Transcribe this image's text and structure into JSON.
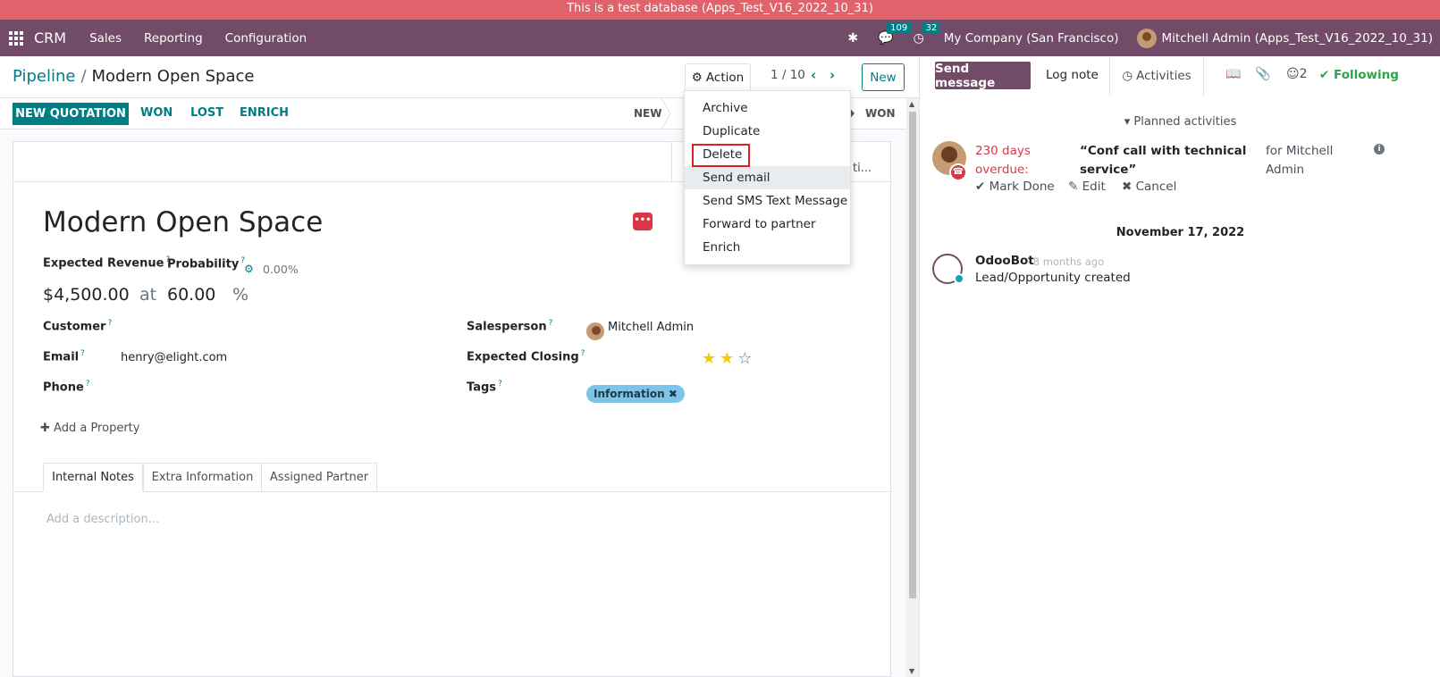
{
  "test_banner": "This is a test database (Apps_Test_V16_2022_10_31)",
  "topnav": {
    "app": "CRM",
    "menu": [
      "Sales",
      "Reporting",
      "Configuration"
    ],
    "messages_count": "109",
    "activities_count": "32",
    "company": "My Company (San Francisco)",
    "user": "Mitchell Admin (Apps_Test_V16_2022_10_31)"
  },
  "control": {
    "breadcrumb_parent": "Pipeline",
    "breadcrumb_sep": "/",
    "breadcrumb_current": "Modern Open Space",
    "action_label": "Action",
    "pager": "1 / 10",
    "new_label": "New"
  },
  "statusbar": {
    "new_quotation": "NEW QUOTATION",
    "won": "WON",
    "lost": "LOST",
    "enrich": "ENRICH",
    "stage_new": "NEW",
    "stage_won": "WON"
  },
  "action_menu": [
    "Archive",
    "Duplicate",
    "Delete",
    "Send email",
    "Send SMS Text Message",
    "Forward to partner",
    "Enrich"
  ],
  "smartbar": {
    "truncated": "ti..."
  },
  "record": {
    "title": "Modern Open Space",
    "expected_revenue_label": "Expected Revenue",
    "probability_label": "Probability",
    "probability_auto": "0.00%",
    "expected_revenue": "$4,500.00",
    "at": "at",
    "probability": "60.00",
    "percent": "%",
    "customer_label": "Customer",
    "email_label": "Email",
    "email": "henry@elight.com",
    "phone_label": "Phone",
    "salesperson_label": "Salesperson",
    "salesperson": "Mitchell Admin",
    "expected_closing_label": "Expected Closing",
    "priority_stars": 2,
    "priority_max": 3,
    "tags_label": "Tags",
    "tag": "Information",
    "add_property": "Add a Property",
    "help_mark": "?"
  },
  "tabs": [
    "Internal Notes",
    "Extra Information",
    "Assigned Partner"
  ],
  "description_placeholder": "Add a description...",
  "chatter": {
    "send_message": "Send message",
    "log_note": "Log note",
    "activities": "Activities",
    "followers_count": "2",
    "following": "Following",
    "planned_activities": "Planned activities",
    "activity": {
      "overdue": "230 days overdue:",
      "summary": "“Conf call with technical service”",
      "for": "for Mitchell Admin",
      "mark_done": "Mark Done",
      "edit": "Edit",
      "cancel": "Cancel"
    },
    "date_separator": "November 17, 2022",
    "message": {
      "author": "OdooBot",
      "time": "- 8 months ago",
      "body": "Lead/Opportunity created"
    }
  },
  "colors": {
    "brand": "#714b67",
    "accent": "#017e84",
    "test_banner": "#e0636b",
    "danger": "#dc3545",
    "success": "#28a745",
    "tag": "#7dc5e8"
  }
}
